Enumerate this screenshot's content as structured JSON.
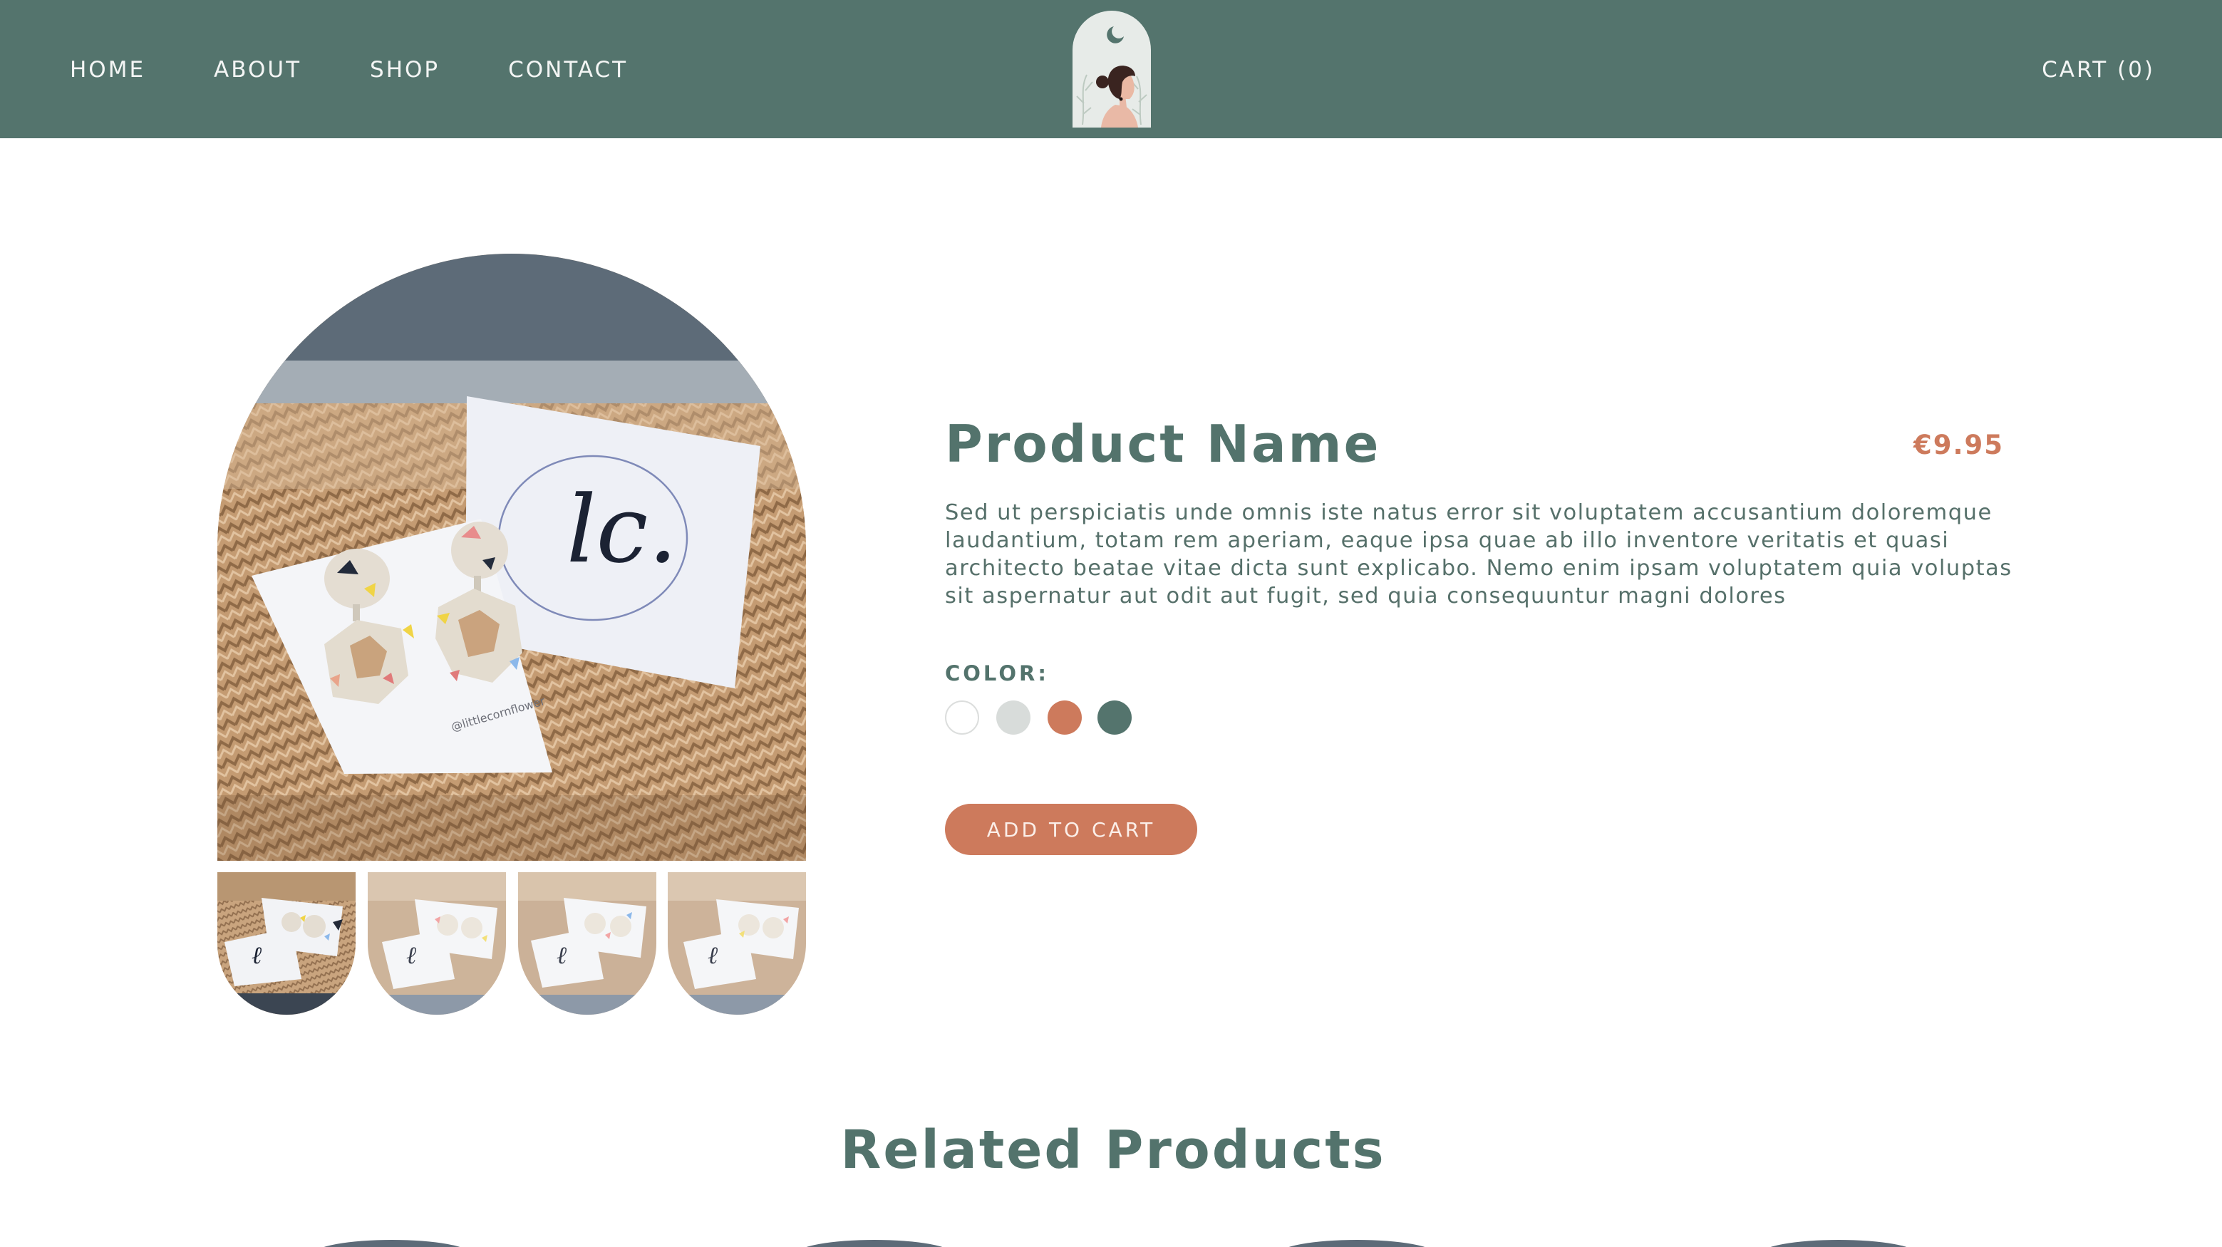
{
  "nav": {
    "items": [
      {
        "label": "HOME"
      },
      {
        "label": "ABOUT"
      },
      {
        "label": "SHOP"
      },
      {
        "label": "CONTACT"
      }
    ],
    "cart_label": "CART (0)"
  },
  "product": {
    "name": "Product Name",
    "price": "€9.95",
    "description": "Sed ut perspiciatis unde omnis iste natus error sit voluptatem accusantium doloremque laudantium, totam rem aperiam, eaque ipsa quae ab illo inventore veritatis et quasi architecto beatae vitae dicta sunt explicabo. Nemo enim ipsam voluptatem quia voluptas sit aspernatur aut odit aut fugit, sed quia consequuntur magni dolores",
    "color_label": "COLOR:",
    "colors": [
      "#ffffff",
      "#d8dcda",
      "#cd7a5c",
      "#54746d"
    ],
    "add_to_cart_label": "ADD TO CART"
  },
  "related": {
    "title": "Related Products"
  },
  "theme": {
    "header_bg": "#54746d",
    "accent": "#cd7a5c",
    "text": "#53736c"
  },
  "icons": {
    "logo": "moon-woman-logo-icon"
  }
}
